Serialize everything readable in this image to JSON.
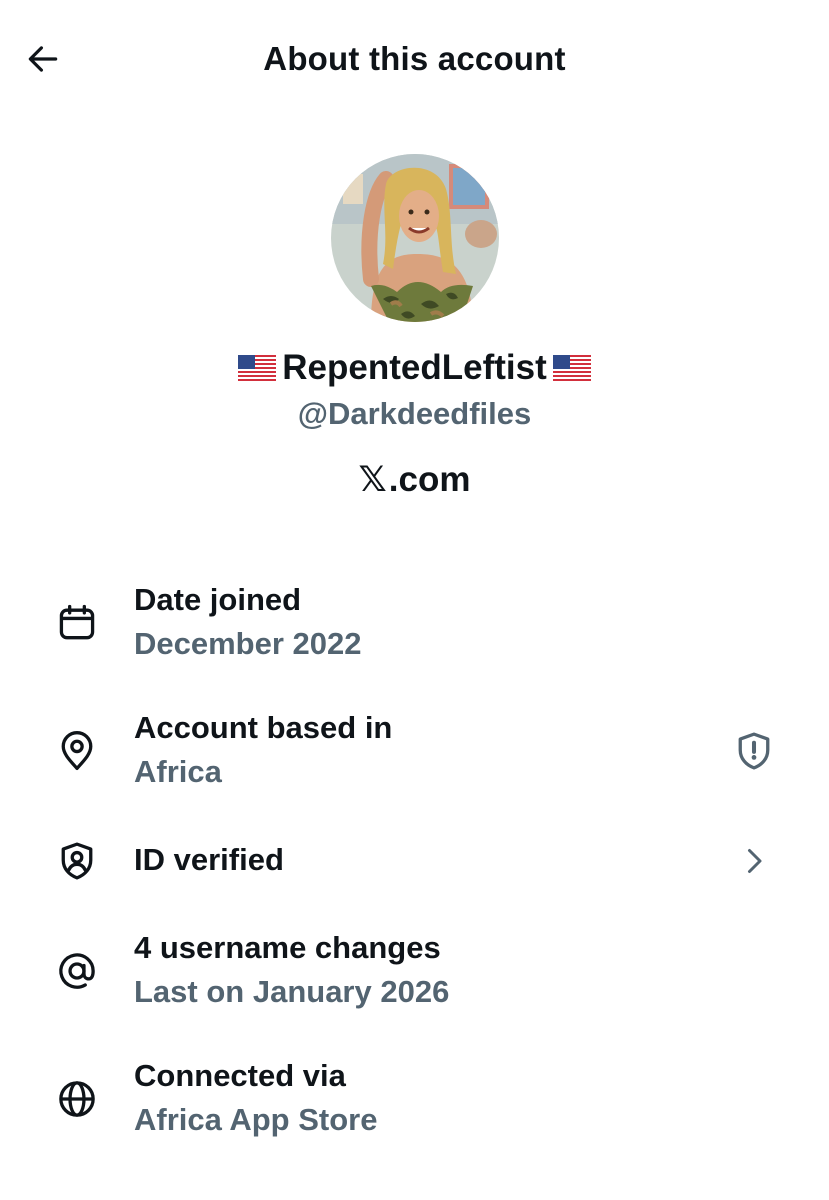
{
  "header": {
    "title": "About this account",
    "back_icon": "arrow-left-icon"
  },
  "profile": {
    "avatar_icon": "profile-avatar",
    "display_name": "RepentedLeftist",
    "flag_icon": "us-flag-icon",
    "handle": "@Darkdeedfiles",
    "platform_mark": "𝕏",
    "platform_text": ".com"
  },
  "details": [
    {
      "icon": "calendar-icon",
      "title": "Date joined",
      "subtitle": "December 2022"
    },
    {
      "icon": "location-pin-icon",
      "title": "Account based in",
      "subtitle": "Africa",
      "right_icon": "shield-alert-icon"
    },
    {
      "icon": "id-badge-icon",
      "title": "ID verified",
      "right_icon": "chevron-right-icon"
    },
    {
      "icon": "at-sign-icon",
      "title": "4 username changes",
      "subtitle": "Last on January 2026"
    },
    {
      "icon": "globe-icon",
      "title": "Connected via",
      "subtitle": "Africa App Store"
    }
  ],
  "colors": {
    "primary_text": "#0f1419",
    "secondary_text": "#536471",
    "background": "#ffffff"
  }
}
